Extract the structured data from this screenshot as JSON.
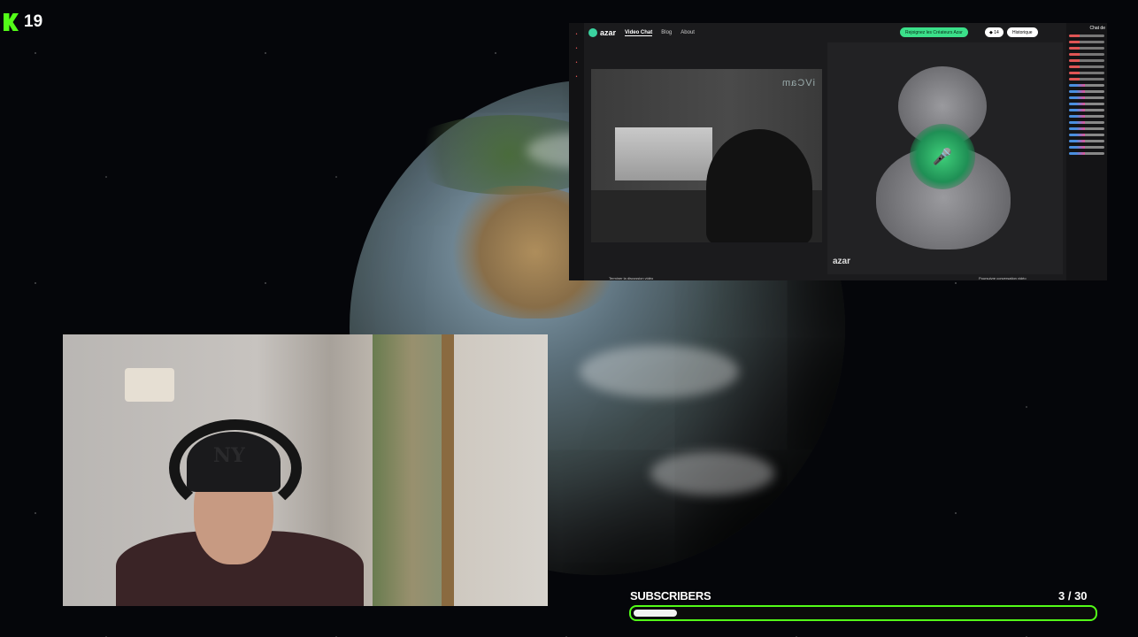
{
  "kick": {
    "viewer_count": "19",
    "logo_color": "#53fc18"
  },
  "azar": {
    "logo_text": "azar",
    "nav": [
      "Video Chat",
      "Blog",
      "About"
    ],
    "join_button": "Rejoignez les Créateurs Azar",
    "gems_count": "14",
    "history_button": "Historique",
    "overlay_watermark": "iVCam",
    "footer_logo": "azar",
    "left_caption": "Terminer la discussion vidéo",
    "right_caption": "Poursuivre conversation vidéo",
    "chat_title": "Chat de"
  },
  "subscribers": {
    "label": "SUBSCRIBERS",
    "count": "3  / 30",
    "current": 3,
    "goal": 30,
    "bar_color": "#53fc18"
  }
}
